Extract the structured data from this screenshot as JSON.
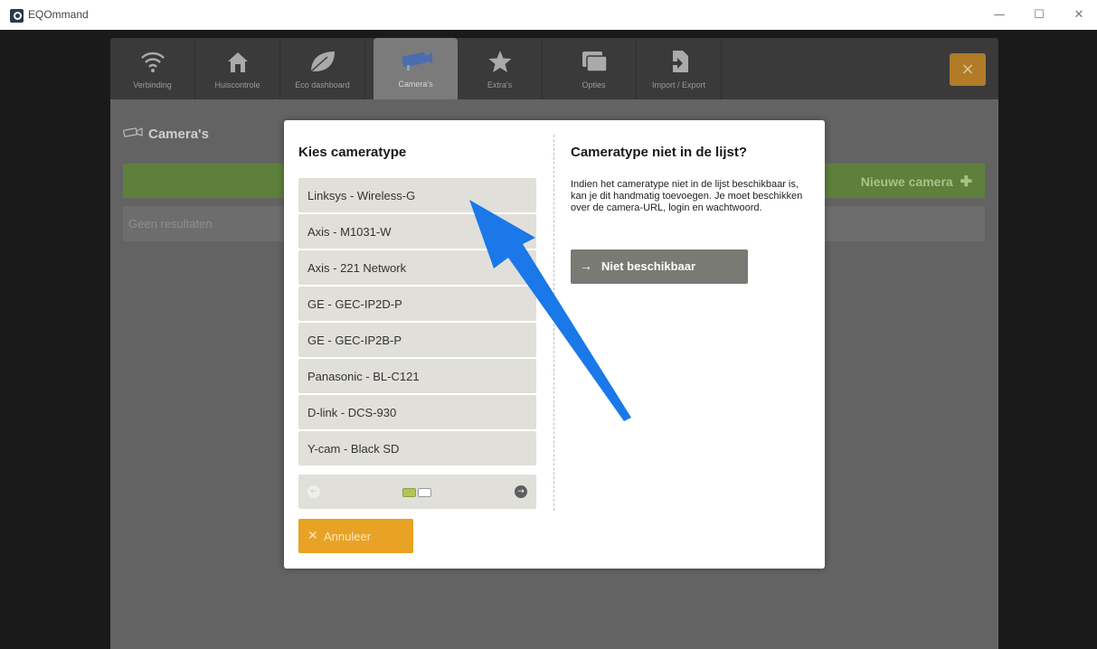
{
  "window": {
    "title": "EQOmmand",
    "minimize_icon": "minimize-icon",
    "maximize_icon": "maximize-icon",
    "close_icon": "close-icon"
  },
  "nav": {
    "items": [
      {
        "label": "Verbinding",
        "icon": "wifi-icon"
      },
      {
        "label": "Huiscontrole",
        "icon": "home-icon"
      },
      {
        "label": "Eco dashboard",
        "icon": "leaf-icon"
      },
      {
        "label": "Camera's",
        "icon": "camera-icon",
        "active": true
      },
      {
        "label": "Extra's",
        "icon": "star-icon"
      },
      {
        "label": "Opties",
        "icon": "windows-icon"
      },
      {
        "label": "Import / Export",
        "icon": "import-export-icon"
      }
    ],
    "close_label": "×"
  },
  "page": {
    "title": "Camera's",
    "new_camera_label": "Nieuwe camera",
    "no_results": "Geen resultaten"
  },
  "modal": {
    "left_title": "Kies cameratype",
    "camera_types": [
      "Linksys - Wireless-G",
      "Axis - M1031-W",
      "Axis - 221 Network",
      "GE - GEC-IP2D-P",
      "GE - GEC-IP2B-P",
      "Panasonic - BL-C121",
      "D-link - DCS-930",
      "Y-cam - Black SD"
    ],
    "pager": {
      "current_page": 1,
      "total_pages": 2
    },
    "cancel_label": "Annuleer",
    "right_title": "Cameratype niet in de lijst?",
    "description": "Indien het cameratype niet in de lijst beschikbaar is, kan je dit handmatig toevoegen. Je moet beschikken over de camera-URL, login en wachtwoord.",
    "not_available_label": "Niet beschikbaar"
  },
  "colors": {
    "accent_orange": "#e8a325",
    "green_bar": "#5f7f3c",
    "arrow_blue": "#1a78e8"
  }
}
